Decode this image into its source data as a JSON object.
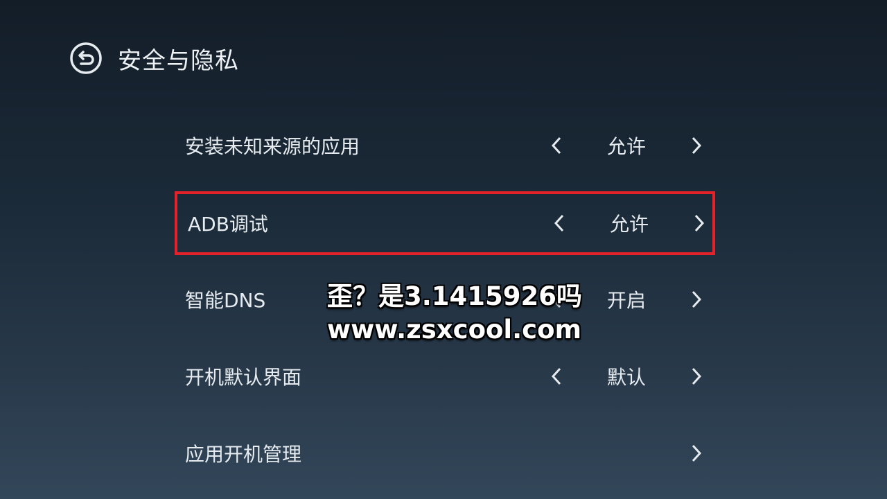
{
  "header": {
    "back_icon": "back-arrow-circle-icon",
    "title": "安全与隐私"
  },
  "settings": [
    {
      "label": "安装未知来源的应用",
      "value": "允许",
      "has_left_arrow": true,
      "has_right_arrow": true,
      "focused": false
    },
    {
      "label": "ADB调试",
      "value": "允许",
      "has_left_arrow": true,
      "has_right_arrow": true,
      "focused": true
    },
    {
      "label": "智能DNS",
      "value": "开启",
      "has_left_arrow": true,
      "has_right_arrow": true,
      "focused": false
    },
    {
      "label": "开机默认界面",
      "value": "默认",
      "has_left_arrow": true,
      "has_right_arrow": true,
      "focused": false
    },
    {
      "label": "应用开机管理",
      "value": "",
      "has_left_arrow": false,
      "has_right_arrow": true,
      "focused": false
    }
  ],
  "overlay": {
    "line1": "歪？是3.1415926吗",
    "line2": "www.zsxcool.com"
  },
  "colors": {
    "focus_border": "#e3222a",
    "text": "#e6ebef",
    "background_top": "#131d28",
    "background_bottom": "#33475a"
  }
}
